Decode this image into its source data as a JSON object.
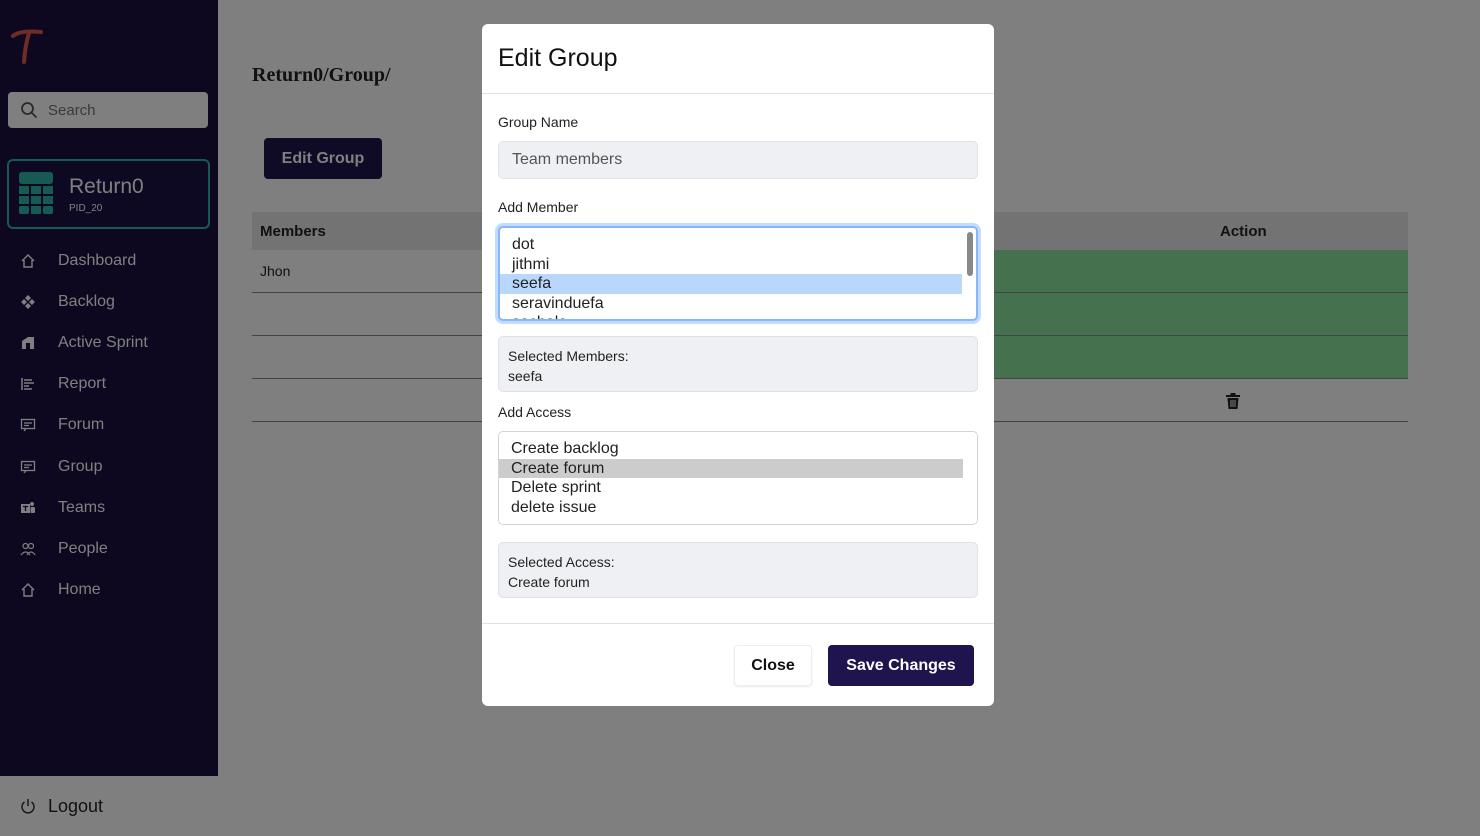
{
  "sidebar": {
    "search_placeholder": "Search",
    "project": {
      "name": "Return0",
      "id": "PID_20"
    },
    "nav": [
      {
        "label": "Dashboard",
        "icon": "home-icon"
      },
      {
        "label": "Backlog",
        "icon": "diamond-icon"
      },
      {
        "label": "Active Sprint",
        "icon": "sprint-icon"
      },
      {
        "label": "Report",
        "icon": "report-icon"
      },
      {
        "label": "Forum",
        "icon": "message-icon"
      },
      {
        "label": "Group",
        "icon": "message-icon"
      },
      {
        "label": "Teams",
        "icon": "teams-icon"
      },
      {
        "label": "People",
        "icon": "people-icon"
      },
      {
        "label": "Home",
        "icon": "home-icon"
      }
    ],
    "logout_label": "Logout"
  },
  "main": {
    "breadcrumb": "Return0/Group/",
    "edit_button_label": "Edit Group",
    "table": {
      "headers": {
        "members": "Members",
        "action": "Action"
      },
      "rows": [
        {
          "member": "Jhon"
        }
      ]
    }
  },
  "modal": {
    "title": "Edit Group",
    "group_name_label": "Group Name",
    "group_name_value": "Team members",
    "add_member_label": "Add Member",
    "member_options": [
      "dot",
      "jithmi",
      "seefa",
      "seravinduefa",
      "sachala"
    ],
    "selected_members_label": "Selected Members:",
    "selected_members_value": "seefa",
    "add_access_label": "Add Access",
    "access_options": [
      "Create backlog",
      "Create forum",
      "Delete sprint",
      "delete issue"
    ],
    "selected_access_label": "Selected Access:",
    "selected_access_value": "Create forum",
    "close_label": "Close",
    "save_label": "Save Changes"
  },
  "colors": {
    "sidebar_bg": "#1a1040",
    "primary": "#1f144d",
    "accent_teal": "#2fb3a6",
    "row_green": "#8be39c",
    "logo_red": "#e05a4f"
  }
}
